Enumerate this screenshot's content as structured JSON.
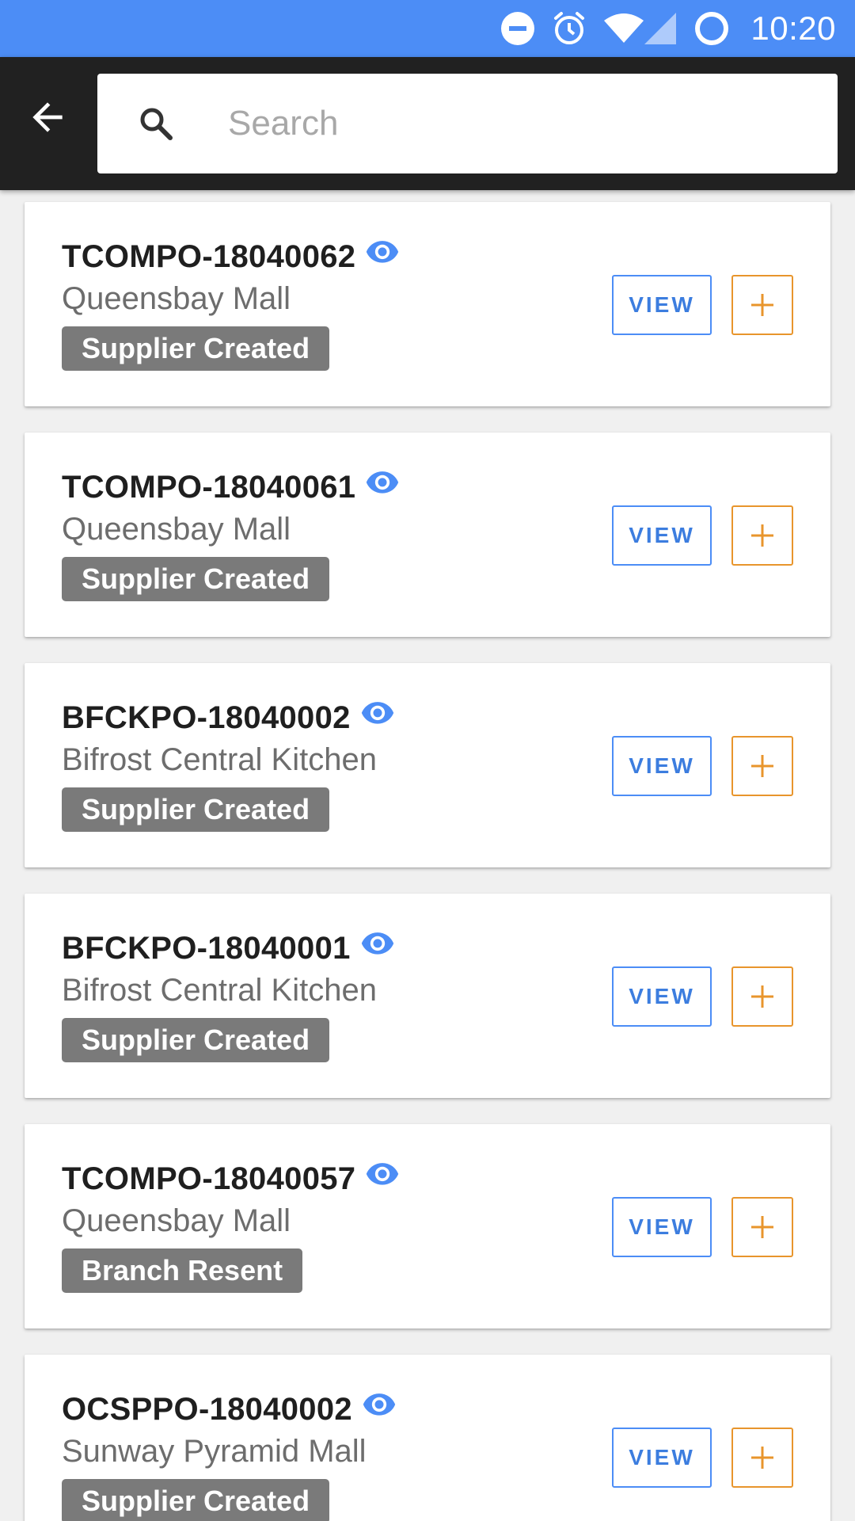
{
  "status_bar": {
    "time": "10:20",
    "icons": [
      "do-not-disturb-icon",
      "alarm-icon",
      "wifi-icon",
      "cell-signal-icon",
      "sync-circle-icon"
    ],
    "background": "#4c8df6"
  },
  "app_bar": {
    "back_icon": "arrow-back-icon",
    "search": {
      "placeholder": "Search",
      "value": "",
      "icon": "search-icon"
    },
    "background": "#212121"
  },
  "orders": [
    {
      "code": "TCOMPO-18040062",
      "location": "Queensbay Mall",
      "status": "Supplier Created",
      "view_label": "VIEW",
      "add_label": "+"
    },
    {
      "code": "TCOMPO-18040061",
      "location": "Queensbay Mall",
      "status": "Supplier Created",
      "view_label": "VIEW",
      "add_label": "+"
    },
    {
      "code": "BFCKPO-18040002",
      "location": "Bifrost Central Kitchen",
      "status": "Supplier Created",
      "view_label": "VIEW",
      "add_label": "+"
    },
    {
      "code": "BFCKPO-18040001",
      "location": "Bifrost Central Kitchen",
      "status": "Supplier Created",
      "view_label": "VIEW",
      "add_label": "+"
    },
    {
      "code": "TCOMPO-18040057",
      "location": "Queensbay Mall",
      "status": "Branch Resent",
      "view_label": "VIEW",
      "add_label": "+"
    },
    {
      "code": "OCSPPO-18040002",
      "location": "Sunway Pyramid Mall",
      "status": "Supplier Created",
      "view_label": "VIEW",
      "add_label": "+"
    }
  ],
  "colors": {
    "accent_blue": "#4c8df6",
    "accent_orange": "#e8952c",
    "status_badge": "#7a7a7a"
  }
}
